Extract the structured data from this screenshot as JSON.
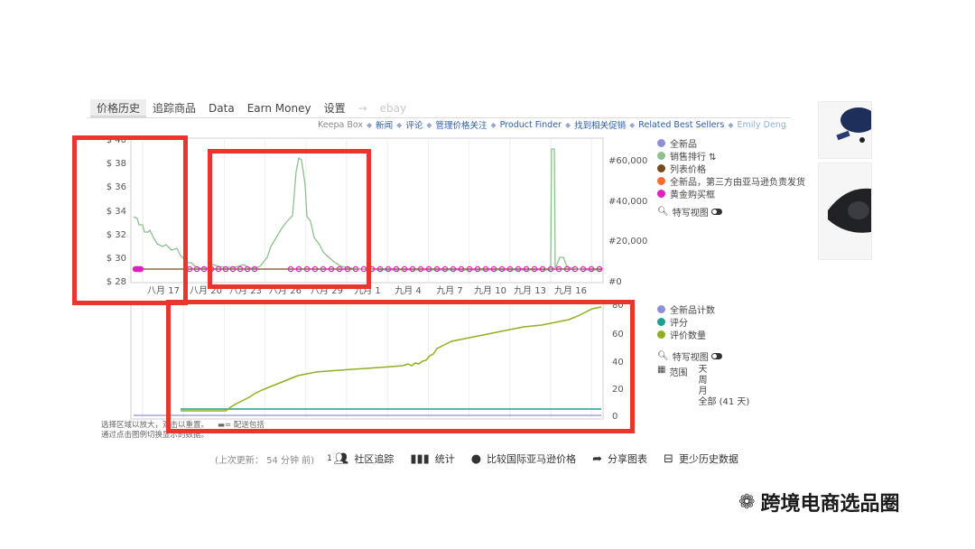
{
  "tabs": [
    {
      "label": "价格历史",
      "active": true
    },
    {
      "label": "追踪商品",
      "active": false
    },
    {
      "label": "Data",
      "active": false
    },
    {
      "label": "Earn Money",
      "active": false
    },
    {
      "label": "设置",
      "active": false
    },
    {
      "label": "→",
      "active": false
    },
    {
      "label": "ebay",
      "active": false
    }
  ],
  "links": [
    {
      "label": "Keepa Box",
      "style": "gray"
    },
    {
      "label": "新闻",
      "style": "normal"
    },
    {
      "label": "评论",
      "style": "normal"
    },
    {
      "label": "管理价格关注",
      "style": "normal"
    },
    {
      "label": "Product Finder",
      "style": "normal"
    },
    {
      "label": "找到相关促销",
      "style": "normal"
    },
    {
      "label": "Related Best Sellers",
      "style": "normal"
    },
    {
      "label": "Emily Deng",
      "style": "light"
    }
  ],
  "price_chart": {
    "y_ticks": [
      "$ 40",
      "$ 38",
      "$ 36",
      "$ 34",
      "$ 32",
      "$ 30",
      "$ 28"
    ],
    "rank_ticks": [
      "#60,000",
      "#40,000",
      "#20,000",
      "#0"
    ],
    "x_ticks": [
      "八月 17",
      "八月 20",
      "八月 23",
      "八月 26",
      "八月 29",
      "九月 1",
      "九月 4",
      "九月 7",
      "九月 10",
      "九月 13",
      "九月 16"
    ]
  },
  "legend_top": [
    {
      "label": "全新品",
      "color": "#8f8fd8"
    },
    {
      "label": "销售排行 ⇅",
      "color": "#8fbf8f"
    },
    {
      "label": "列表价格",
      "color": "#7a4a1f"
    },
    {
      "label": "全新品，第三方由亚马逊负责发货",
      "color": "#ff6a30"
    },
    {
      "label": "黄金购买框",
      "color": "#e020c0"
    }
  ],
  "zoom_label_top": "特写视图",
  "review_chart": {
    "y_ticks": [
      "80",
      "60",
      "40",
      "20",
      "0"
    ]
  },
  "legend_bottom": [
    {
      "label": "全新品计数",
      "color": "#8f8fd8"
    },
    {
      "label": "评分",
      "color": "#1f9f8f"
    },
    {
      "label": "评价数量",
      "color": "#8fb020"
    }
  ],
  "zoom_label_bottom": "特写视图",
  "range": {
    "label": "范围",
    "options": [
      "天",
      "周",
      "月",
      "全部 (41 天)"
    ]
  },
  "notes": {
    "line1": "选择区域以放大，双击以重置。",
    "line1b": "= 配送包括",
    "line2": "通过点击图例切换显示的数据。"
  },
  "bottom": {
    "updated": "(上次更新：  54 分钟  前)",
    "count": "1",
    "community": "社区追踪",
    "stats": "统计",
    "compare": "比较国际亚马逊价格",
    "share": "分享图表",
    "less": "更少历史数据"
  },
  "watermark": "跨境电商选品圈"
}
